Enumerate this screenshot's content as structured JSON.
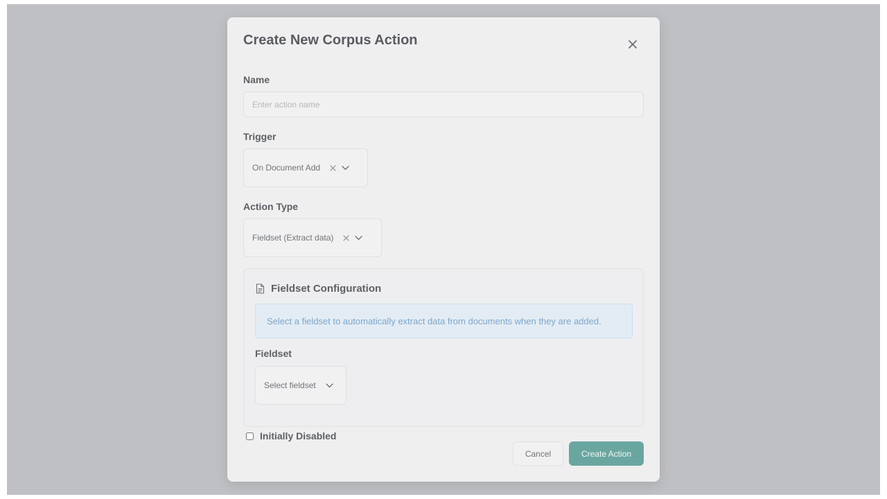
{
  "modal": {
    "title": "Create New Corpus Action"
  },
  "form": {
    "name_label": "Name",
    "name_placeholder": "Enter action name",
    "name_value": "",
    "trigger_label": "Trigger",
    "trigger_value": "On Document Add",
    "action_type_label": "Action Type",
    "action_type_value": "Fieldset (Extract data)",
    "initially_disabled_label": "Initially Disabled",
    "initially_disabled_checked": false
  },
  "fieldset_config": {
    "title": "Fieldset Configuration",
    "info_text": "Select a fieldset to automatically extract data from documents when they are added.",
    "fieldset_label": "Fieldset",
    "fieldset_placeholder": "Select fieldset"
  },
  "buttons": {
    "cancel": "Cancel",
    "create": "Create Action"
  },
  "icons": {
    "close": "close-icon",
    "clear": "x-icon",
    "dropdown": "chevron-down-icon",
    "config": "document-icon"
  },
  "colors": {
    "primary": "#6aa6a0",
    "info_bg": "#e3ecf4",
    "info_text": "#7da7cc",
    "backdrop": "#bfc0c4"
  }
}
